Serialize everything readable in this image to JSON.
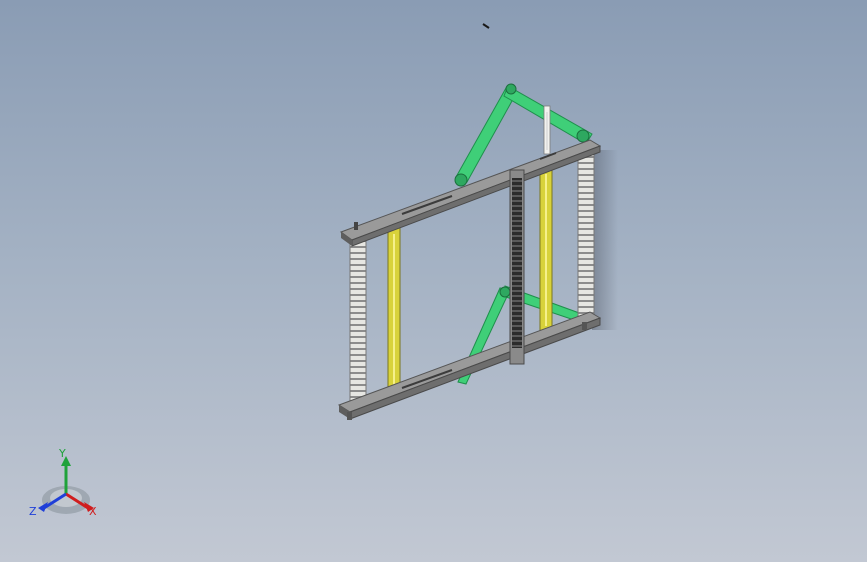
{
  "viewport": {
    "background_top": "#8a9cb4",
    "background_bottom": "#c2c8d3"
  },
  "model": {
    "colors": {
      "frame": "#6e6e6e",
      "frame_light": "#9a9a9a",
      "link": "#3fcf78",
      "link_dark": "#229a52",
      "spring": "#d8d23a",
      "rack": "#e2e2de",
      "screw": "#2f2f2f"
    }
  },
  "triad": {
    "x_label": "X",
    "y_label": "Y",
    "z_label": "Z",
    "x_color": "#d01d1d",
    "y_color": "#1fa23a",
    "z_color": "#1f3fd8"
  }
}
